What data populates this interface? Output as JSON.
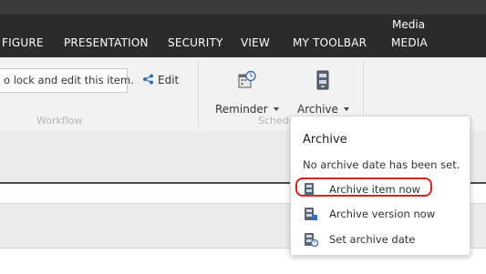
{
  "tabs": {
    "context_label": "Media",
    "items": [
      {
        "key": "configure",
        "label": "FIGURE"
      },
      {
        "key": "presentation",
        "label": "PRESENTATION"
      },
      {
        "key": "security",
        "label": "SECURITY"
      },
      {
        "key": "view",
        "label": "VIEW"
      },
      {
        "key": "my_toolbar",
        "label": "MY TOOLBAR"
      },
      {
        "key": "media",
        "label": "MEDIA"
      }
    ]
  },
  "ribbon": {
    "lock_message": "o lock and edit this item.",
    "workflow_group_label": "Workflow",
    "edit_label": "Edit",
    "reminder_label": "Reminder",
    "archive_label": "Archive",
    "schedule_group_label": "Schedu"
  },
  "archive_menu": {
    "title": "Archive",
    "note": "No archive date has been set.",
    "items": [
      {
        "label": "Archive item now",
        "icon": "archive-item-icon"
      },
      {
        "label": "Archive version now",
        "icon": "archive-version-icon"
      },
      {
        "label": "Set archive date",
        "icon": "archive-date-icon"
      }
    ]
  },
  "colors": {
    "tabbar": "#2b2b2b",
    "highlight": "#d9221f"
  }
}
